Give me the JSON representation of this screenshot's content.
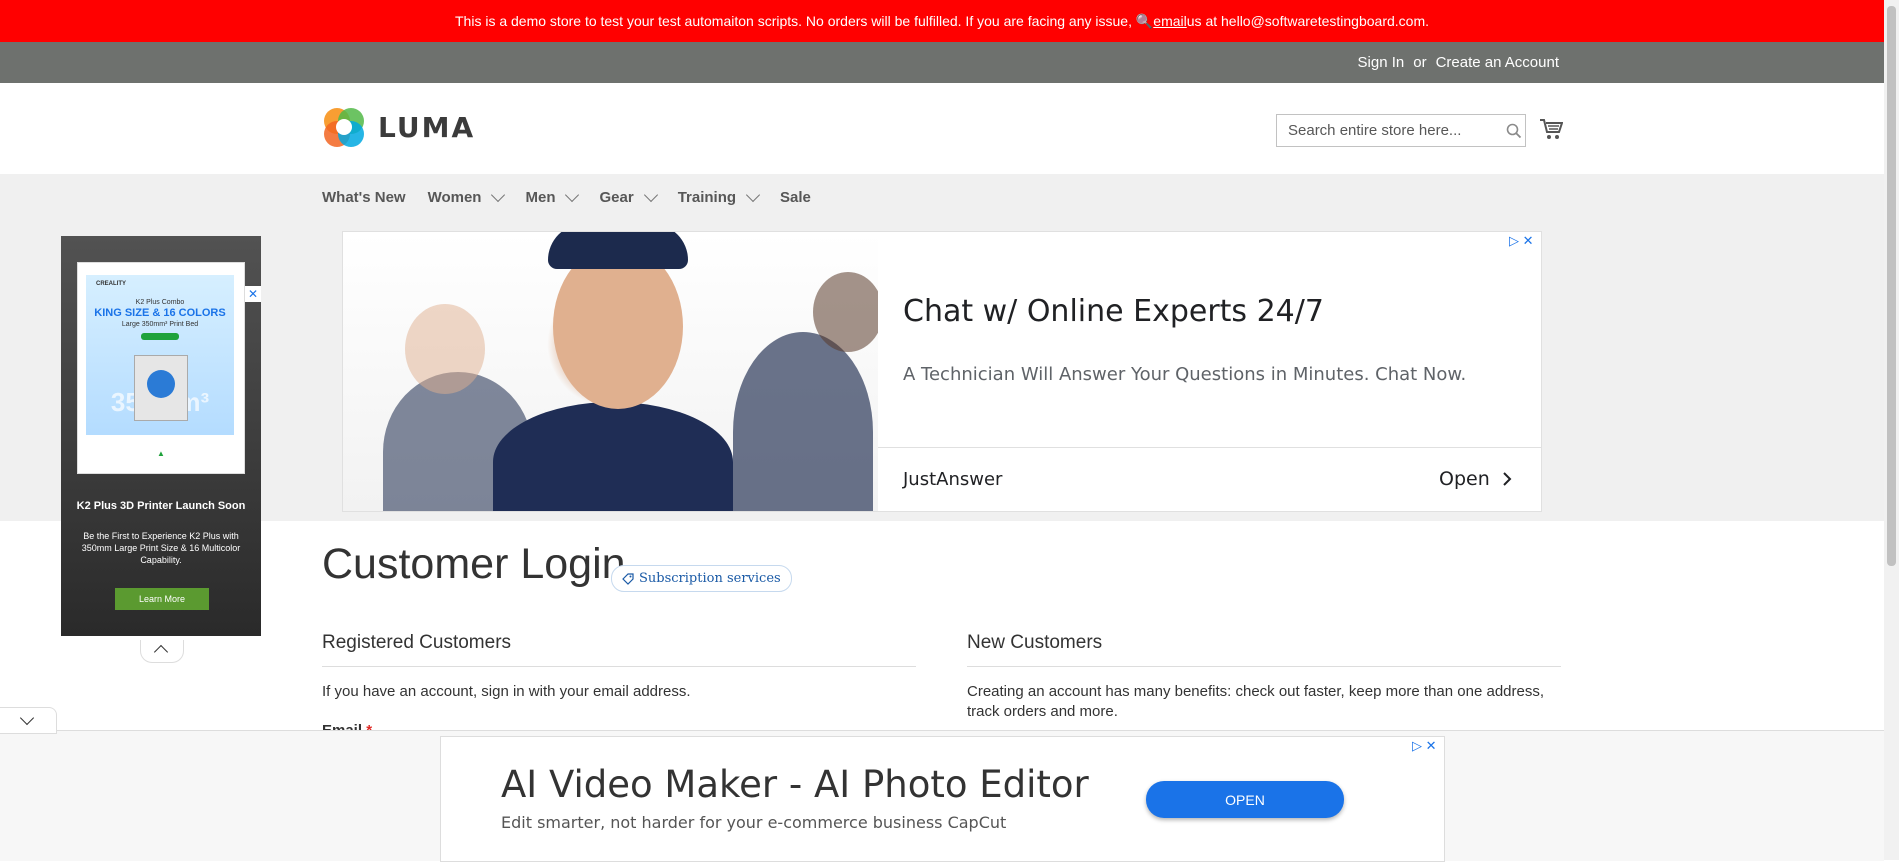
{
  "demo_banner": {
    "text_before": "This is a demo store to test your test automaiton scripts. No orders will be fulfilled. If you are facing any issue, 🔍 ",
    "email_link": "email",
    "text_after": " us at hello@softwaretestingboard.com."
  },
  "header": {
    "sign_in": "Sign In",
    "or": "or",
    "create_account": "Create an Account",
    "logo_text": "LUMA",
    "search_placeholder": "Search entire store here...",
    "cart_icon": "cart-icon"
  },
  "nav": {
    "items": [
      {
        "label": "What's New",
        "dropdown": false
      },
      {
        "label": "Women",
        "dropdown": true
      },
      {
        "label": "Men",
        "dropdown": true
      },
      {
        "label": "Gear",
        "dropdown": true
      },
      {
        "label": "Training",
        "dropdown": true
      },
      {
        "label": "Sale",
        "dropdown": false
      }
    ]
  },
  "side_ad": {
    "brand": "CREALITY",
    "sub": "K2 Plus Combo",
    "big": "KING SIZE & 16 COLORS",
    "small": "Large 350mm³ Print Bed",
    "mm": "350mm³",
    "mark": "▲",
    "title": "K2 Plus 3D Printer Launch Soon",
    "desc": "Be the First to Experience K2 Plus with 350mm Large Print Size & 16 Multicolor Capability.",
    "button": "Learn More"
  },
  "main_ad": {
    "title": "Chat w/ Online Experts 24/7",
    "desc": "A Technician Will Answer Your Questions in Minutes. Chat Now.",
    "brand": "JustAnswer",
    "open": "Open"
  },
  "page": {
    "title": "Customer Login",
    "subscription_badge": "Subscription services",
    "registered": {
      "title": "Registered Customers",
      "text": "If you have an account, sign in with your email address.",
      "email_label": "Email",
      "required_mark": "*"
    },
    "new_customers": {
      "title": "New Customers",
      "text": "Creating an account has many benefits: check out faster, keep more than one address, track orders and more."
    }
  },
  "bottom_ad": {
    "title": "AI Video Maker - AI Photo Editor",
    "desc": "Edit smarter, not harder for your e-commerce business CapCut",
    "button": "OPEN"
  },
  "colors": {
    "banner": "#ff0000",
    "panel": "#6e716e",
    "link_blue": "#1a73e8"
  }
}
